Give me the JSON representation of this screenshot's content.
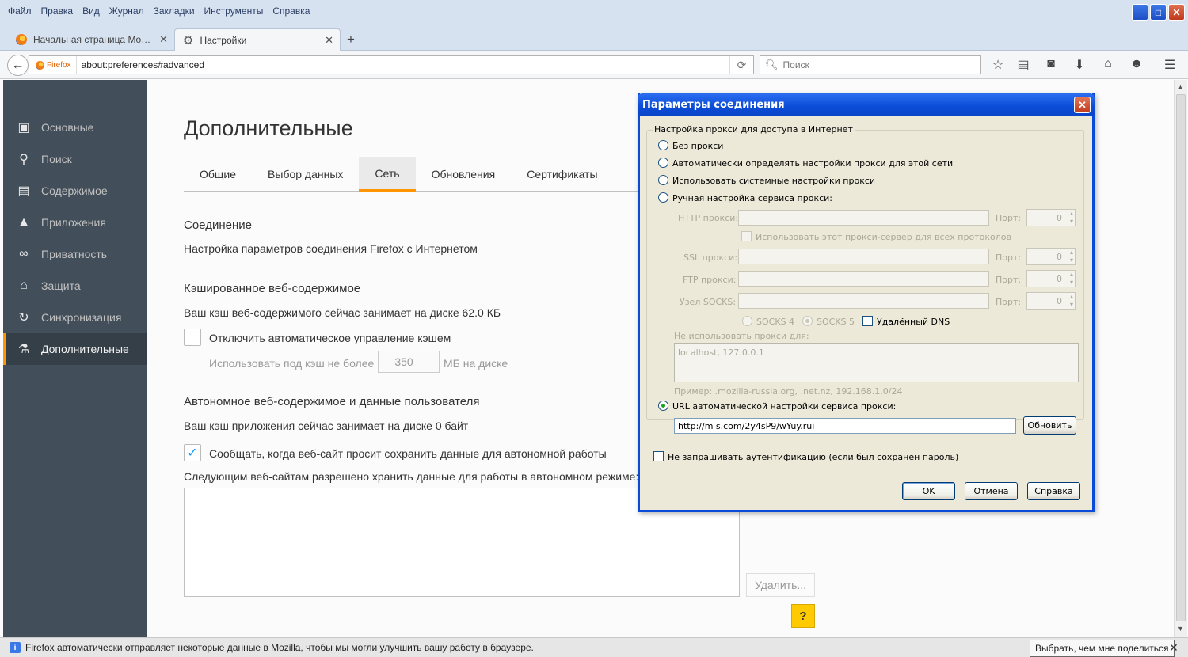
{
  "menu": [
    "Файл",
    "Правка",
    "Вид",
    "Журнал",
    "Закладки",
    "Инструменты",
    "Справка"
  ],
  "window_controls": {
    "minimize": "_",
    "maximize": "□",
    "close": "✕"
  },
  "tabs": [
    {
      "title": "Начальная страница Mozilla ...",
      "icon": "firefox-icon",
      "close": "✕"
    },
    {
      "title": "Настройки",
      "icon": "gear-icon",
      "close": "✕"
    }
  ],
  "new_tab": "+",
  "nav": {
    "identity_label": "Firefox",
    "url": "about:preferences#advanced",
    "search_placeholder": "Поиск"
  },
  "sidebar": {
    "items": [
      {
        "label": "Основные",
        "icon": "general-icon"
      },
      {
        "label": "Поиск",
        "icon": "search-icon"
      },
      {
        "label": "Содержимое",
        "icon": "content-icon"
      },
      {
        "label": "Приложения",
        "icon": "applications-icon"
      },
      {
        "label": "Приватность",
        "icon": "privacy-mask-icon"
      },
      {
        "label": "Защита",
        "icon": "lock-icon"
      },
      {
        "label": "Синхронизация",
        "icon": "sync-icon"
      },
      {
        "label": "Дополнительные",
        "icon": "advanced-icon"
      }
    ],
    "active": "Дополнительные"
  },
  "prefs": {
    "title": "Дополнительные",
    "tabs": [
      "Общие",
      "Выбор данных",
      "Сеть",
      "Обновления",
      "Сертификаты"
    ],
    "active_tab": "Сеть",
    "connection_heading": "Соединение",
    "connection_text": "Настройка параметров соединения Firefox с Интернетом",
    "cache_heading": "Кэшированное веб-содержимое",
    "cache_text": "Ваш кэш веб-содержимого сейчас занимает на диске 62.0 КБ",
    "cache_override_label": "Отключить автоматическое управление кэшем",
    "cache_limit_prefix": "Использовать под кэш не более",
    "cache_limit_value": "350",
    "cache_limit_suffix": "МБ на диске",
    "offline_heading": "Автономное веб-содержимое и данные пользователя",
    "offline_text": "Ваш кэш приложения сейчас занимает на диске 0 байт",
    "offline_notify_label": "Сообщать, когда веб-сайт просит сохранить данные для автономной работы",
    "offline_notify_checked": true,
    "offline_sites_label": "Следующим веб-сайтам разрешено хранить данные для работы в автономном режиме:",
    "remove_button": "Удалить...",
    "help_button": "?"
  },
  "notification": {
    "text": "Firefox автоматически отправляет некоторые данные в Mozilla, чтобы мы могли улучшить вашу работу в браузере.",
    "button": "Выбрать, чем мне поделиться",
    "close": "✕"
  },
  "dialog": {
    "title": "Параметры соединения",
    "close": "✕",
    "group_label": "Настройка прокси для доступа в Интернет",
    "options": {
      "no_proxy": "Без прокси",
      "auto_detect": "Автоматически определять настройки прокси для этой сети",
      "system": "Использовать системные настройки прокси",
      "manual": "Ручная настройка сервиса прокси:",
      "auto_url": "URL автоматической настройки сервиса прокси:"
    },
    "selected_option": "auto_url",
    "http_label": "HTTP прокси:",
    "ssl_label": "SSL прокси:",
    "ftp_label": "FTP прокси:",
    "socks_label": "Узел SOCKS:",
    "port_label": "Порт:",
    "port_value": "0",
    "share_proxy_label": "Использовать этот прокси-сервер для всех протоколов",
    "socks4_label": "SOCKS 4",
    "socks5_label": "SOCKS 5",
    "remote_dns_label": "Удалённый DNS",
    "no_proxy_for_label": "Не использовать прокси для:",
    "no_proxy_for_value": "localhost, 127.0.0.1",
    "example_text": "Пример: .mozilla-russia.org, .net.nz, 192.168.1.0/24",
    "pac_url": "http://m           s.com/2y4sP9/wYuy.rui",
    "reload_button": "Обновить",
    "no_auth_label": "Не запрашивать аутентификацию (если был сохранён пароль)",
    "ok_button": "OK",
    "cancel_button": "Отмена",
    "help_button": "Справка"
  }
}
